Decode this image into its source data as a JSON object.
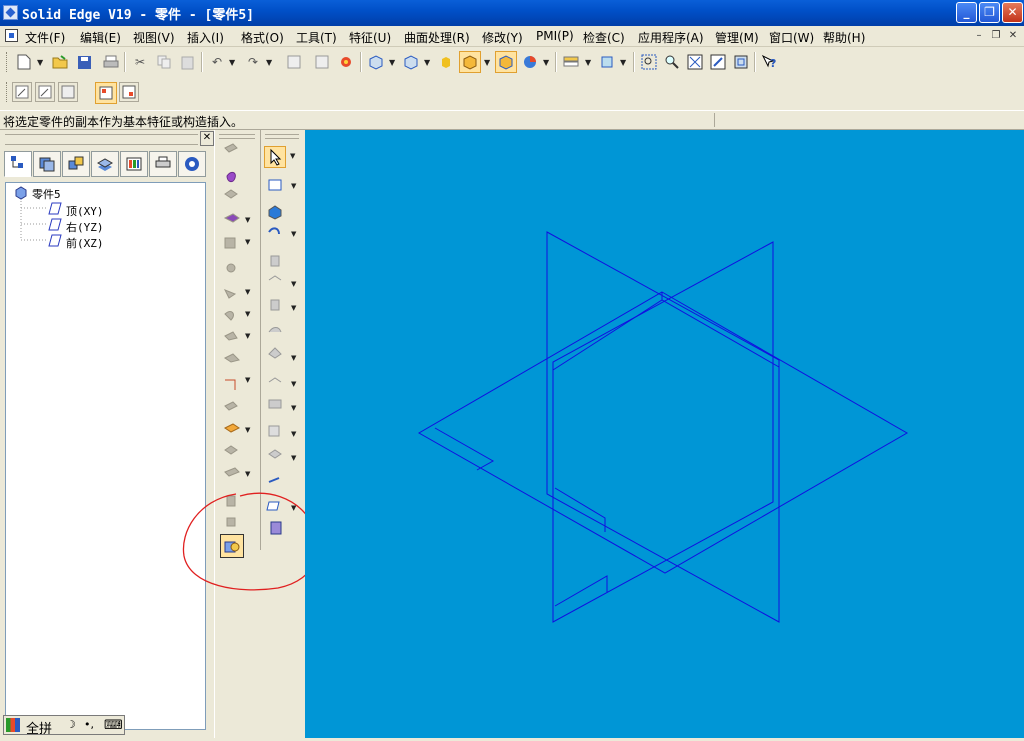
{
  "window": {
    "title": "Solid Edge V19 - 零件 - [零件5]",
    "minimize_label": "_",
    "maximize_label": "❐",
    "close_label": "✕"
  },
  "menu": {
    "items": [
      "文件(F)",
      "编辑(E)",
      "视图(V)",
      "插入(I)",
      "格式(O)",
      "工具(T)",
      "特征(U)",
      "曲面处理(R)",
      "修改(Y)",
      "PMI(P)",
      "检查(C)",
      "应用程序(A)",
      "管理(M)",
      "窗口(W)",
      "帮助(H)"
    ],
    "mdi_minimize": "–",
    "mdi_restore": "❐",
    "mdi_close": "✕"
  },
  "prompt": {
    "text": "将选定零件的副本作为基本特征或构造插入。"
  },
  "pathfinder": {
    "close_label": "✕",
    "root": "零件5",
    "planes": [
      "顶(XY)",
      "右(YZ)",
      "前(XZ)"
    ]
  },
  "ime": {
    "mode": "全拼",
    "moon": "☽",
    "punct": "•,",
    "keyboard": "⌨"
  },
  "colors": {
    "viewport_bg": "#0096d6",
    "wireframe": "#1010e0",
    "highlight_circle": "#e02020",
    "titlebar": "#0055d4"
  }
}
